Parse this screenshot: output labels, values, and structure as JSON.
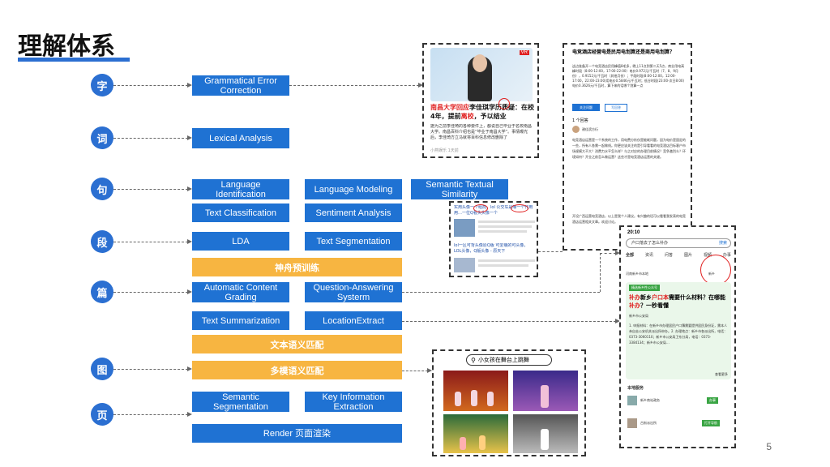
{
  "title": "理解体系",
  "page_number": "5",
  "levels": [
    "字",
    "词",
    "句",
    "段",
    "篇",
    "图",
    "页"
  ],
  "tasks": {
    "grammatical_error_correction": "Grammatical Error Correction",
    "lexical_analysis": "Lexical Analysis",
    "language_identification": "Language Identification",
    "language_modeling": "Language Modeling",
    "semantic_textual_similarity": "Semantic Textual Similarity",
    "text_classification": "Text Classification",
    "sentiment_analysis": "Sentiment Analysis",
    "lda": "LDA",
    "text_segmentation": "Text Segmentation",
    "shenzhou_pretrain": "神舟预训练",
    "automatic_content_grading": "Automatic Content Grading",
    "question_answering_system": "Question-Answering Systerm",
    "text_summarization": "Text Summarization",
    "location_extract": "LocationExtract",
    "text_semantic_match": "文本语义匹配",
    "multimodal_semantic_match": "多模语义匹配",
    "semantic_segmentation": "Semantic Segmentation",
    "key_info_extraction": "Key Information Extraction",
    "render": "Render 页面渲染"
  },
  "news_card": {
    "badge": "VR",
    "headline_red": "南昌大学回应",
    "headline_mid": "李佳琪学历质疑：在校",
    "headline_line2_a": "4年，提前",
    "headline_line2_red": "离校",
    "headline_line2_b": "，予以结业",
    "body": "据为之前李佳琦的各种要件上，都说自己毕业于名校南昌大学。南昌百科介绍也是“毕业于南昌大学”。事情曝光后，李佳琦方立马就将百科信息修改删除了",
    "source": "小燕娱乐",
    "time": "1天前"
  },
  "qa_card": {
    "title": "电竞酒店经营电是民用电划算还是商用电划算？",
    "body": "这边准备开一个电竞酒店民用峰值8毛多，晚上11点到第二天5点，商业用电高峰时段（8:00-12:00，17:00-22:00）电价0.972元/千瓦时（7、8、9月份），0.9152元/千瓦时（其他月份）；平段时段(8:00-12:00，12:00-17:00，22:00-23:00)用电价0.5846元/千瓦时；低谷时段(23:00-次日8:00)电价0.3626元/千瓦时，算下来的话哪个划算一点",
    "follow_btn": "关注问题",
    "answer_btn": "写回答",
    "answer_count": "1 个回答",
    "answerer": "谢佳滨方衍",
    "answer_text": "电竞酒店运营是一个系统的工作，用电费分析仅是能耗问题，因为电价是固定的一些，所有人各需一起做线。你更应该关注的是引导看看的电竞酒店目标客户市场规模大不大？消费力水平怎么样？与之对应的办理目前情况？竞争激烈么？环境如何？开业之前怎么做运营？这些才是电竞酒店运营的关键。",
    "footer": "开设广西运营电竞酒店，以上是我个人建议。有兴趣的话可以看看我发表的电竞酒店运营相关文章。欢迎讨论。"
  },
  "similar_card": {
    "q1": "实用头像一个组局，lol 公交车是哪一个作用用…一位Q看头头像一个",
    "q2": "lol一区可背头像原Q版 可爱萌的可头像，LOL头像，Q版头像 - 原天下"
  },
  "phone_card": {
    "time": "20:10",
    "search": "户口落去了怎么补办",
    "search_btn": "搜索",
    "tabs": [
      "全部",
      "资讯",
      "问答",
      "图片",
      "视频",
      "办事"
    ],
    "service_tag": "河南新乡市本地",
    "location": "新乡",
    "tag": "精选新乡性公众号",
    "q_red1": "补办",
    "q_text1": "新乡",
    "q_red2": "户口本",
    "q_text2": "需要什么材料？在哪能",
    "q_red3": "补办",
    "q_text3": "？一秒看懂",
    "official": "新乡市公安局",
    "answer": "1. 申报材料：在新乡市办理居民户口簿需要提供居民身份证，需本人亲自去公安机关派出所申办。2. 办理地点：新乡市各派出所，电话：0373-3060110；新乡市公安局卫东分局，电话：0373-3384134；新乡市公安局…",
    "more": "查看更多",
    "local_title": "本地服务",
    "svc1": "新乡南站政务",
    "svc1_btn": "办事",
    "svc2": "古街派出所",
    "svc2_btn": "打开导航"
  },
  "image_search": {
    "query": "小女孩在舞台上跳舞"
  }
}
